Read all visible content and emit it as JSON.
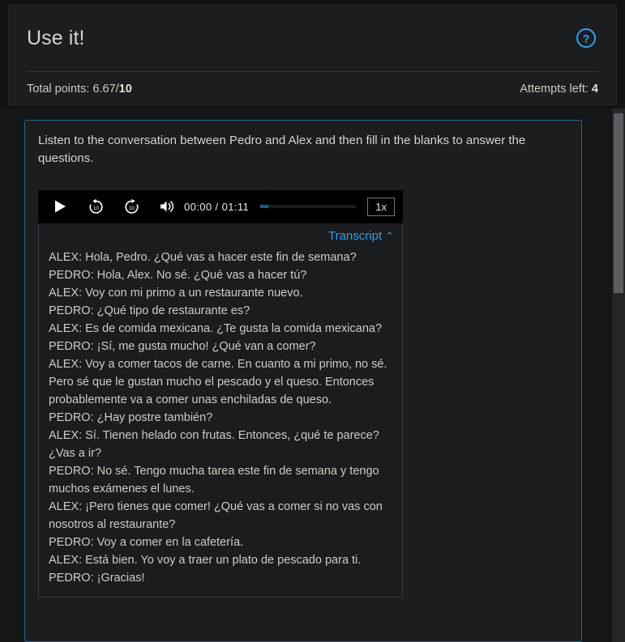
{
  "header": {
    "title": "Use it!",
    "help_icon": "question-circle-icon",
    "points_label": "Total points: 6.67/",
    "points_total": "10",
    "attempts_label": "Attempts left: ",
    "attempts_value": "4"
  },
  "exercise": {
    "instructions": "Listen to the conversation between Pedro and Alex and then fill in the blanks to answer the questions."
  },
  "audio": {
    "play_icon": "play-icon",
    "rewind_icon": "rewind-10-icon",
    "forward_icon": "forward-10-icon",
    "volume_icon": "volume-icon",
    "current_time": "00:00",
    "separator": "/",
    "duration": "01:11",
    "time_display": "00:00 / 01:11",
    "speed_label": "1x",
    "progress_percent": 8,
    "fill_color": "#14607d"
  },
  "transcript": {
    "toggle_label": "Transcript",
    "chevron": "⌃",
    "chevron_icon": "chevron-up-icon",
    "expanded": true,
    "lines": [
      "ALEX: Hola, Pedro. ¿Qué vas a hacer este fin de semana?",
      "PEDRO: Hola, Alex. No sé. ¿Qué vas a hacer tú?",
      "ALEX: Voy con mi primo a un restaurante nuevo.",
      "PEDRO: ¿Qué tipo de restaurante es?",
      "ALEX: Es de comida mexicana. ¿Te gusta la comida mexicana?",
      "PEDRO: ¡Sí, me gusta mucho! ¿Qué van a comer?",
      "ALEX: Voy a comer tacos de carne. En cuanto a mi primo, no sé. Pero sé que le gustan mucho el pescado y el queso. Entonces probablemente va a comer unas enchiladas de queso.",
      "PEDRO: ¿Hay postre también?",
      "ALEX: Sí. Tienen helado con frutas. Entonces, ¿qué te parece? ¿Vas a ir?",
      "PEDRO: No sé. Tengo mucha tarea este fin de semana y tengo muchos exámenes el lunes.",
      "ALEX: ¡Pero tienes que comer! ¿Qué vas a comer si no vas con nosotros al restaurante?",
      "PEDRO: Voy a comer en la cafetería.",
      "ALEX: Está bien. Yo voy a traer un plato de pescado para ti.",
      "PEDRO: ¡Gracias!"
    ]
  },
  "colors": {
    "accent_blue": "#3c9ae8",
    "panel_border": "#1d6b8e",
    "background": "#141617",
    "card": "#1b1d1f"
  }
}
